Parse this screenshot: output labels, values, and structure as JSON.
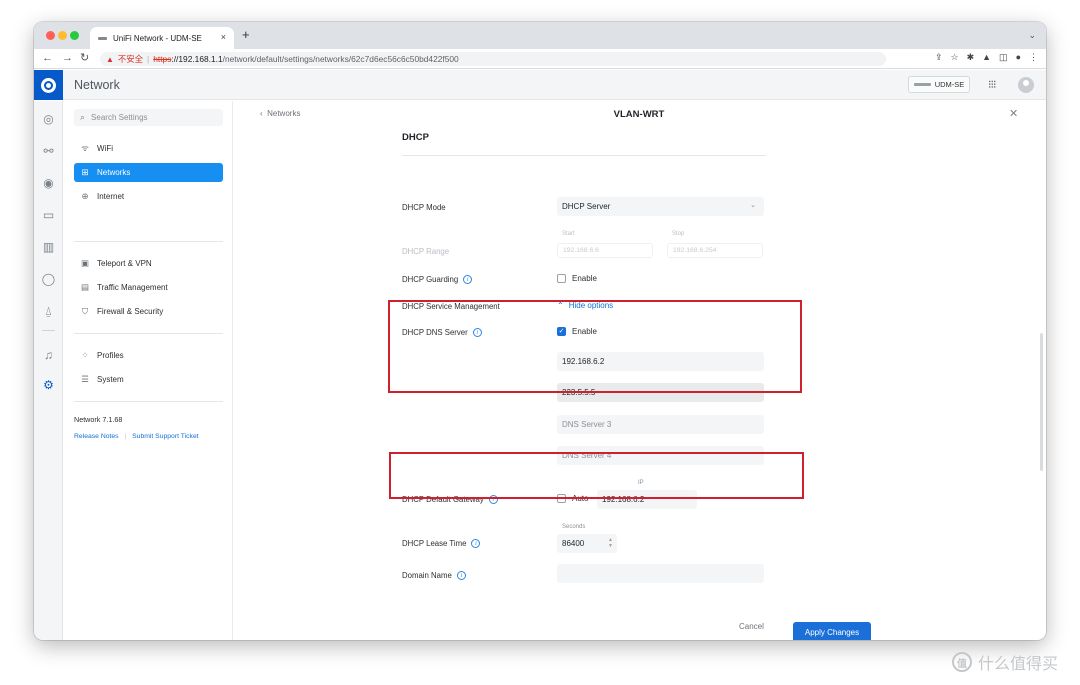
{
  "browser": {
    "tab_title": "UniFi Network - UDM-SE",
    "tab_close": "×",
    "new_tab": "+",
    "security_label": "不安全",
    "url_scheme": "https",
    "url_host": "://192.168.1.1",
    "url_path": "/network/default/settings/networks/62c7d6ec56c6c50bd422f500"
  },
  "app": {
    "title": "Network",
    "device_name": "UDM-SE"
  },
  "sidebar": {
    "search_placeholder": "Search Settings",
    "items": [
      {
        "label": "WiFi",
        "icon": "wifi-icon"
      },
      {
        "label": "Networks",
        "icon": "network-topology-icon",
        "active": true
      },
      {
        "label": "Internet",
        "icon": "globe-icon"
      },
      {
        "label": "Teleport & VPN",
        "icon": "teleport-icon"
      },
      {
        "label": "Traffic Management",
        "icon": "traffic-icon"
      },
      {
        "label": "Firewall & Security",
        "icon": "shield-icon"
      },
      {
        "label": "Profiles",
        "icon": "profiles-icon"
      },
      {
        "label": "System",
        "icon": "system-icon"
      }
    ],
    "version": "Network 7.1.68",
    "release_notes": "Release Notes",
    "support": "Submit Support Ticket"
  },
  "panel": {
    "back_label": "Networks",
    "title": "VLAN-WRT",
    "section": "DHCP",
    "dhcp_mode_label": "DHCP Mode",
    "dhcp_mode_value": "DHCP Server",
    "dhcp_range_label": "DHCP Range",
    "range_start_caption": "Start",
    "range_start": "192.168.6.6",
    "range_stop_caption": "Stop",
    "range_stop": "192.168.6.254",
    "guarding_label": "DHCP Guarding",
    "guarding_enable": "Enable",
    "service_mgmt_label": "DHCP Service Management",
    "hide_options": "Hide options",
    "dns_label": "DHCP DNS Server",
    "dns_enable": "Enable",
    "dns_servers": [
      "192.168.6.2",
      "223.5.5.5"
    ],
    "dns_placeholders": [
      "DNS Server 3",
      "DNS Server 4"
    ],
    "gateway_label": "DHCP Default Gateway",
    "gateway_auto": "Auto",
    "gateway_ip_caption": "IP",
    "gateway_ip": "192.168.6.2",
    "lease_label": "DHCP Lease Time",
    "lease_caption": "Seconds",
    "lease_value": "86400",
    "domain_label": "Domain Name",
    "domain_value": "",
    "cancel": "Cancel",
    "apply": "Apply Changes"
  },
  "watermark": {
    "badge": "值",
    "text": "什么值得买"
  },
  "colors": {
    "accent": "#1b6fd8",
    "active_nav": "#168ef2",
    "highlight_box": "#d0202e",
    "logo_tile": "#0559c9"
  }
}
